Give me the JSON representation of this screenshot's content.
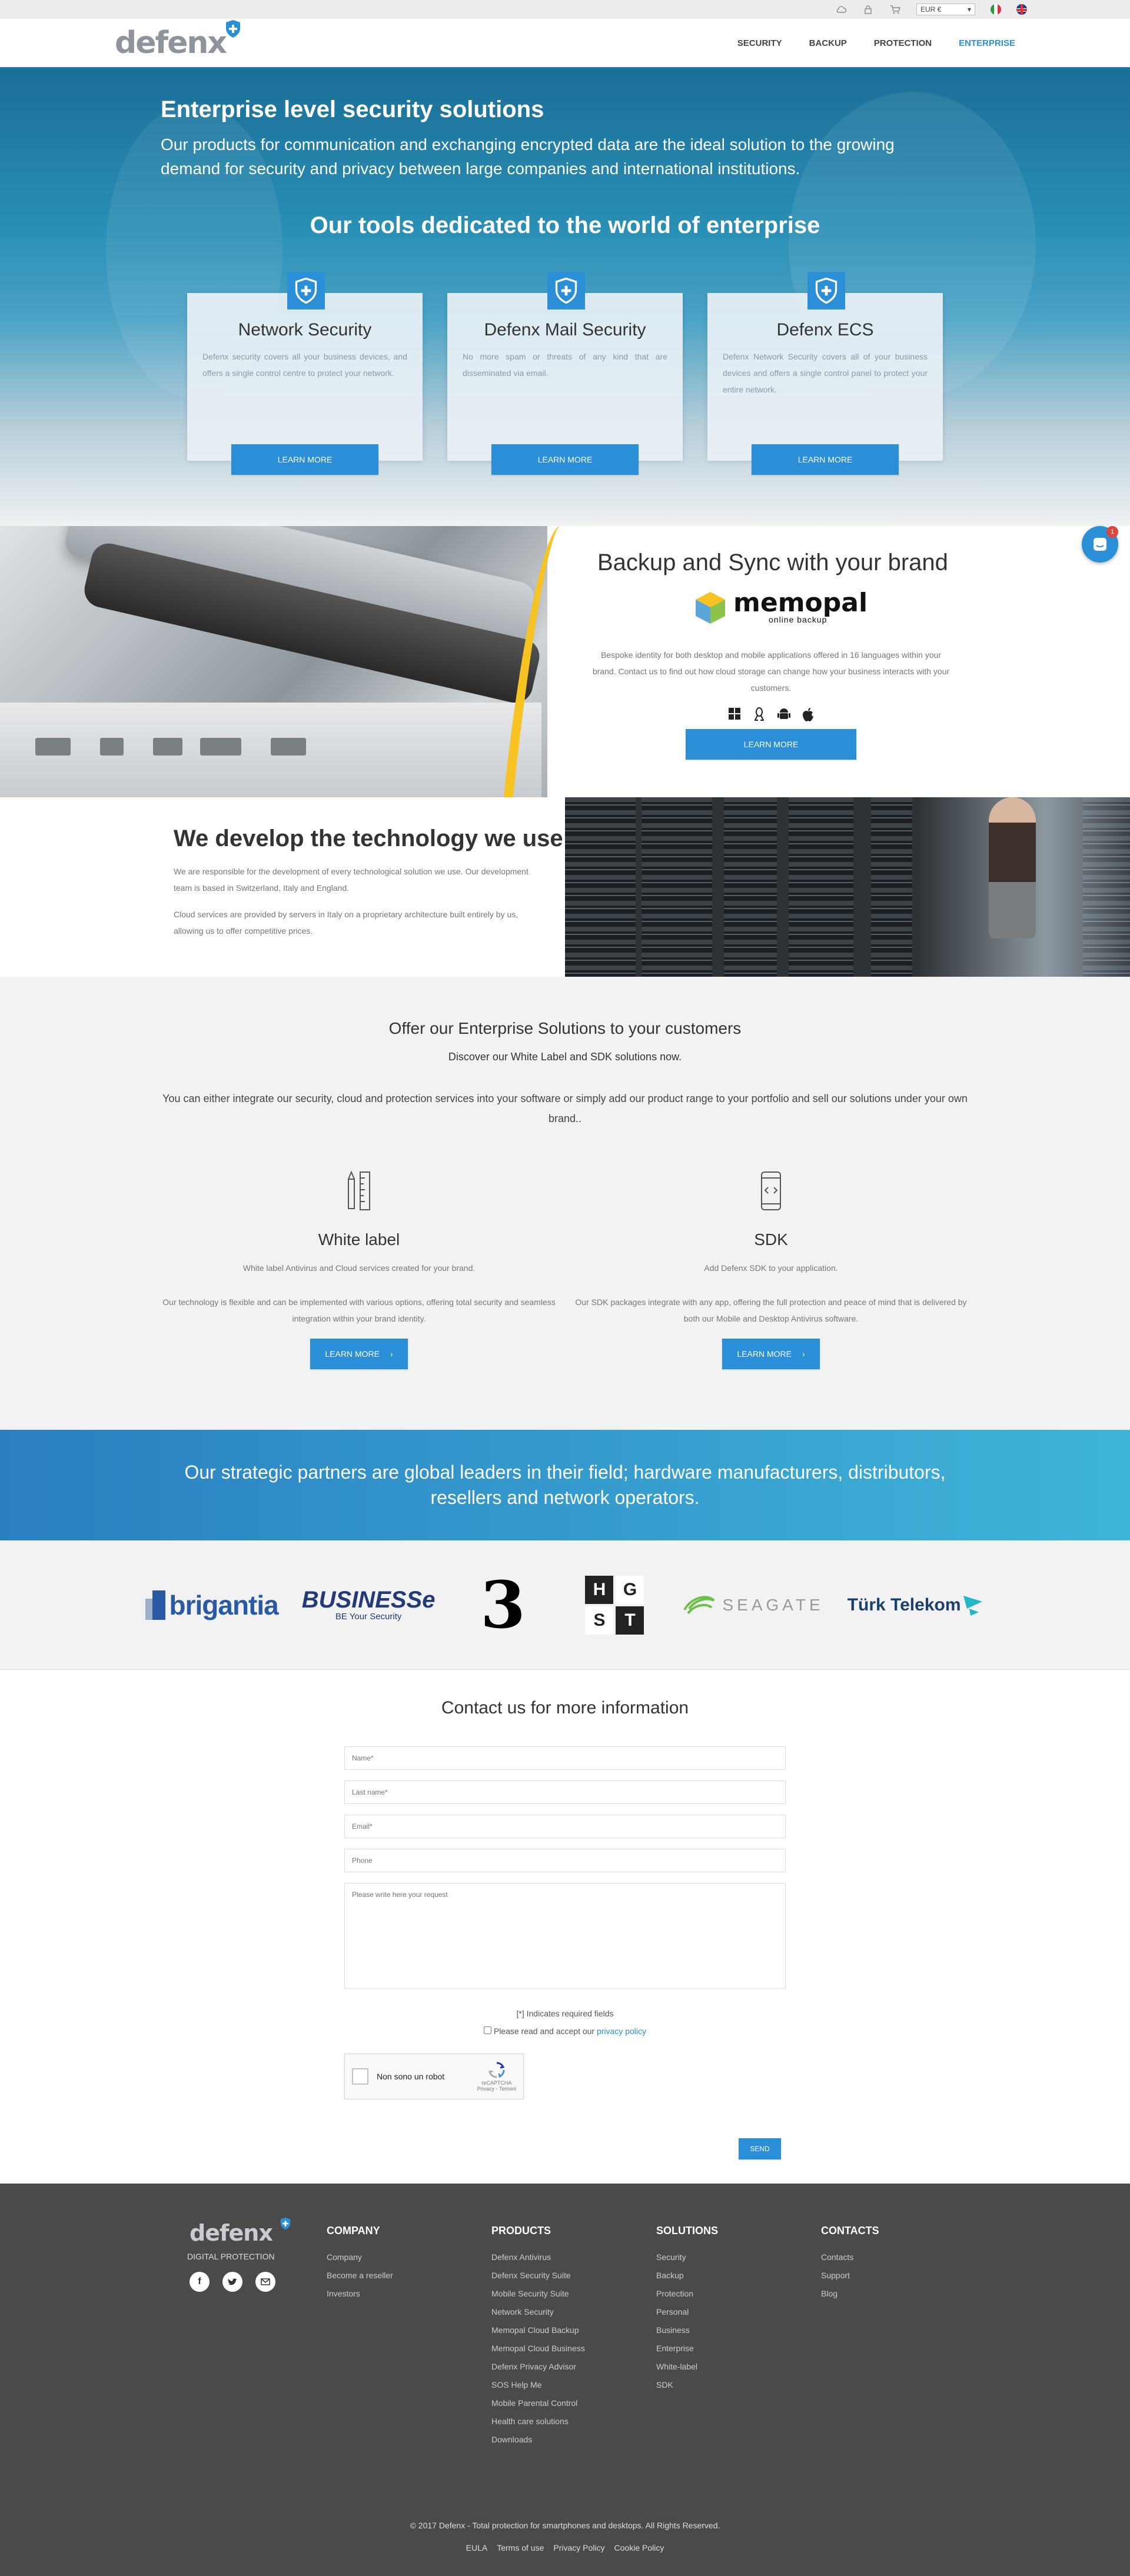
{
  "topbar": {
    "currency": "EUR €"
  },
  "brand": {
    "name": "defenx"
  },
  "nav": [
    "SECURITY",
    "BACKUP",
    "PROTECTION",
    "ENTERPRISE"
  ],
  "hero": {
    "title": "Enterprise level security solutions",
    "lead": "Our products for communication and exchanging encrypted data are the ideal solution to the growing demand for security and privacy between large companies and international institutions.",
    "tools_title": "Our tools dedicated to the world of enterprise",
    "cards": [
      {
        "title": "Network Security",
        "text": "Defenx security covers all your business devices, and offers a single control centre to protect your network.",
        "button": "LEARN MORE"
      },
      {
        "title": "Defenx Mail Security",
        "text": "No more spam or threats of any kind that are disseminated via email.",
        "button": "LEARN MORE"
      },
      {
        "title": "Defenx ECS",
        "text": "Defenx Network Security covers all of your business devices and offers a single control panel to protect your entire network.",
        "button": "LEARN MORE"
      }
    ]
  },
  "backup": {
    "title": "Backup and Sync with your brand",
    "logo_word": "memopal",
    "logo_sub": "online backup",
    "text": "Bespoke identity for both desktop and mobile applications offered in 16 languages within your brand. Contact us to find out how cloud storage can change how your business interacts with your customers.",
    "button": "LEARN MORE"
  },
  "develop": {
    "title": "We develop the technology we use",
    "p1": "We are responsible for the development of every technological solution we use. Our development team is based in Switzerland, Italy and England.",
    "p2": "Cloud services are provided by servers in Italy on a proprietary architecture built entirely by us, allowing us to offer competitive prices."
  },
  "offer": {
    "title": "Offer our Enterprise Solutions to your customers",
    "sub": "Discover our White Label and SDK solutions now.",
    "body": "You can either integrate our security, cloud and protection services into your software or simply add our product range to your portfolio and sell our solutions under your own brand..",
    "white": {
      "title": "White label",
      "p1": "White label Antivirus and Cloud services created for your brand.",
      "p2": "Our technology is flexible and can be implemented with various options, offering total security and seamless integration within your brand identity.",
      "button": "LEARN MORE"
    },
    "sdk": {
      "title": "SDK",
      "p1": "Add Defenx SDK to your application.",
      "p2": "Our SDK packages integrate with any app, offering the full protection and peace of mind that is delivered by both our Mobile and Desktop Antivirus software.",
      "button": "LEARN MORE"
    }
  },
  "partners": {
    "banner": "Our strategic partners are global leaders in their field; hardware manufacturers, distributors, resellers and network operators.",
    "logos": {
      "brigantia": "brigantia",
      "business": "BUSINESSe",
      "business_sub": "BE Your Security",
      "three": "3",
      "hgst": [
        "H",
        "G",
        "S",
        "T"
      ],
      "seagate": "SEAGATE",
      "turk": "Türk Telekom"
    }
  },
  "contact": {
    "title": "Contact us for more information",
    "name_ph": "Name*",
    "last_ph": "Last name*",
    "email_ph": "Email*",
    "phone_ph": "Phone",
    "request_ph": "Please write here your request",
    "required": "[*] Indicates required fields",
    "privacy_prefix": "Please read and accept our",
    "privacy_link": "privacy policy",
    "captcha": "Non sono un robot",
    "captcha_brand": "reCAPTCHA",
    "captcha_terms": "Privacy - Termini",
    "send": "SEND"
  },
  "footer": {
    "brand": "defenx",
    "tagline": "DIGITAL PROTECTION",
    "company": {
      "title": "COMPANY",
      "items": [
        "Company",
        "Become a reseller",
        "Investors"
      ]
    },
    "products": {
      "title": "PRODUCTS",
      "items": [
        "Defenx Antivirus",
        "Defenx Security Suite",
        "Mobile Security Suite",
        "Network Security",
        "Memopal Cloud Backup",
        "Memopal Cloud Business",
        "Defenx Privacy Advisor",
        "SOS Help Me",
        "Mobile Parental Control",
        "Health care solutions",
        "Downloads"
      ]
    },
    "solutions": {
      "title": "SOLUTIONS",
      "items": [
        "Security",
        "Backup",
        "Protection",
        "Personal",
        "Business",
        "Enterprise",
        "White-label",
        "SDK"
      ]
    },
    "contacts": {
      "title": "CONTACTS",
      "items": [
        "Contacts",
        "Support",
        "Blog"
      ]
    },
    "copyright": "© 2017 Defenx - Total protection for smartphones and desktops. All Rights Reserved.",
    "links": [
      "EULA",
      "Terms of use",
      "Privacy Policy",
      "Cookie Policy"
    ]
  },
  "chat": {
    "count": "1"
  }
}
